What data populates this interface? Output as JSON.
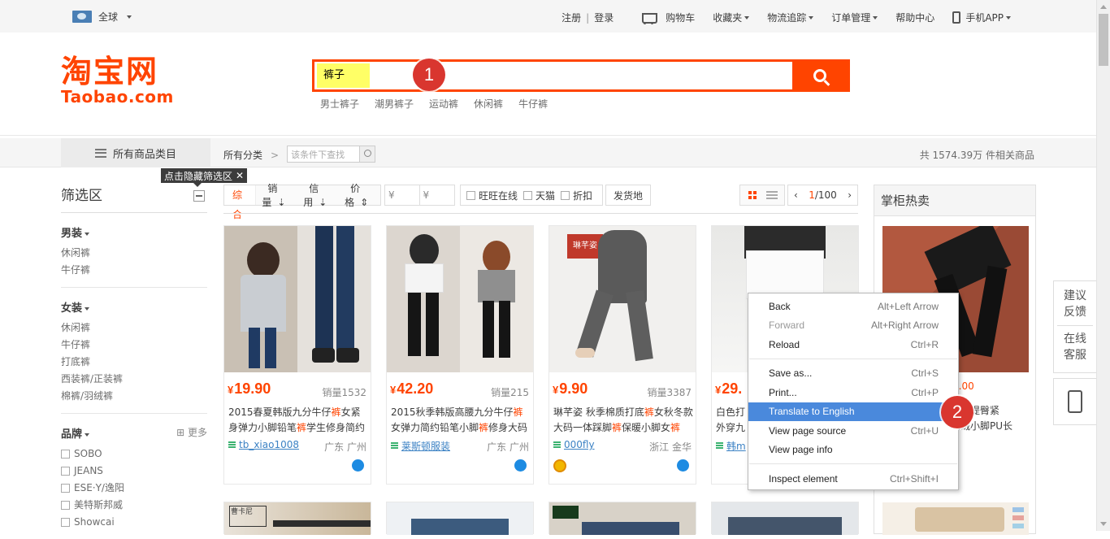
{
  "topbar": {
    "region": "全球",
    "register": "注册",
    "login": "登录",
    "cart": "购物车",
    "favorites": "收藏夹",
    "logistics": "物流追踪",
    "orders": "订单管理",
    "help": "帮助中心",
    "mobile_app": "手机APP"
  },
  "header": {
    "logo_cn": "淘宝网",
    "logo_en": "Taobao.com",
    "search_query": "裤子",
    "hot_words": [
      "男士裤子",
      "潮男裤子",
      "运动裤",
      "休闲裤",
      "牛仔裤"
    ]
  },
  "annotations": {
    "badge_1": "1",
    "badge_2": "2"
  },
  "catbar": {
    "all_categories": "所有商品类目",
    "all_classes": "所有分类",
    "crumb_arrow": ">",
    "filter_placeholder": "该条件下查找",
    "total_prefix": "共",
    "total_count": "1574.39万",
    "total_suffix": "件相关商品"
  },
  "sidebar": {
    "tooltip": "点击隐藏筛选区",
    "tooltip_close": "✕",
    "title": "筛选区",
    "groups": [
      {
        "title": "男装",
        "items": [
          "休闲裤",
          "牛仔裤"
        ]
      },
      {
        "title": "女装",
        "items": [
          "休闲裤",
          "牛仔裤",
          "打底裤",
          "西装裤/正装裤",
          "棉裤/羽绒裤"
        ]
      }
    ],
    "brand": {
      "title": "品牌",
      "more": "更多",
      "items": [
        "SOBO",
        "JEANS",
        "ESE·Y/逸阳",
        "美特斯邦威",
        "Showcai"
      ]
    }
  },
  "sortbar": {
    "comprehensive": "综合",
    "sales": "销量",
    "credit": "信用",
    "price": "价格",
    "price_from": "¥",
    "price_to": "¥",
    "wangwang": "旺旺在线",
    "tmall": "天猫",
    "discount": "折扣",
    "ship_from": "发货地",
    "page_current": "1",
    "page_total": "/100"
  },
  "products": [
    {
      "price_symbol": "¥",
      "price": "19.90",
      "sold": "销量1532",
      "title_parts": [
        "2015春夏韩版九分牛仔",
        "裤",
        "女紧身弹力小脚铅笔",
        "裤",
        "学生修身简约"
      ],
      "shop": "tb_xiao1008",
      "location": "广东 广州"
    },
    {
      "price_symbol": "¥",
      "price": "42.20",
      "sold": "销量215",
      "title_parts": [
        "2015秋季韩版高腰九分牛仔",
        "裤",
        "女弹力简约铅笔小脚",
        "裤",
        "修身大码"
      ],
      "shop": "莱斯顿服装",
      "location": "广东 广州"
    },
    {
      "price_symbol": "¥",
      "price": "9.90",
      "sold": "销量3387",
      "title_parts": [
        "琳芊姿 秋季棉质打底",
        "裤",
        "女秋冬款大码一体踩脚",
        "裤",
        "保暖小脚女",
        "裤"
      ],
      "shop": "000fly",
      "location": "浙江 金华",
      "image_text": "琳芊姿"
    },
    {
      "price_symbol": "¥",
      "price": "29.",
      "sold": "",
      "title_parts": [
        "白色打",
        "",
        "外穿九"
      ],
      "shop": "韩m",
      "location": ""
    }
  ],
  "hot_sale": {
    "title": "掌柜热卖",
    "price_tail": "0.00",
    "title_text": "显瘦提臀紧\n加绒小脚PU长"
  },
  "float_panel": {
    "feedback": "建议反馈",
    "service": "在线客服"
  },
  "context_menu": {
    "items": [
      {
        "label": "Back",
        "shortcut": "Alt+Left Arrow"
      },
      {
        "label": "Forward",
        "shortcut": "Alt+Right Arrow"
      },
      {
        "label": "Reload",
        "shortcut": "Ctrl+R"
      },
      {
        "label": "Save as...",
        "shortcut": "Ctrl+S"
      },
      {
        "label": "Print...",
        "shortcut": "Ctrl+P"
      },
      {
        "label": "Translate to English",
        "shortcut": ""
      },
      {
        "label": "View page source",
        "shortcut": "Ctrl+U"
      },
      {
        "label": "View page info",
        "shortcut": ""
      },
      {
        "label": "Inspect element",
        "shortcut": "Ctrl+Shift+I"
      }
    ]
  },
  "colors": {
    "brand_orange": "#ff4400",
    "menu_highlight": "#4a89dc",
    "badge_red": "#d9362f"
  }
}
